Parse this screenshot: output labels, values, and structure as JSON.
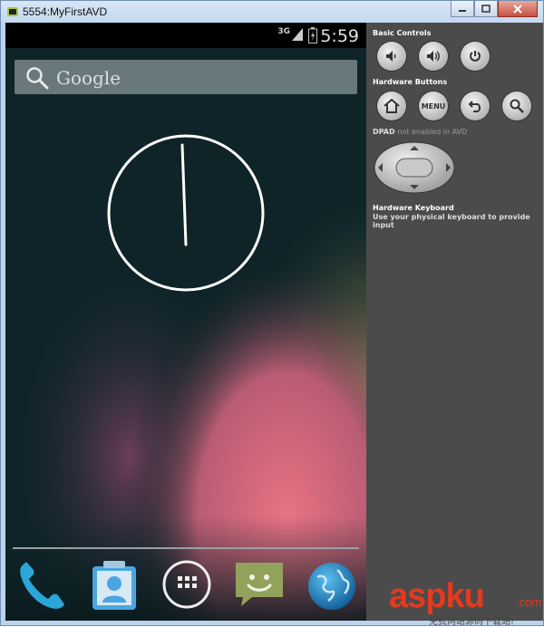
{
  "window": {
    "title": "5554:MyFirstAVD",
    "controls": [
      "minimize-icon",
      "maximize-icon",
      "close-icon"
    ]
  },
  "statusbar": {
    "network": "3G",
    "time": "5:59",
    "icons": [
      "signal-icon",
      "battery-icon"
    ]
  },
  "search": {
    "text": "Google",
    "icon": "search-icon"
  },
  "home": {
    "clock_widget": "analog-clock",
    "dock_apps": [
      {
        "name": "phone",
        "icon": "phone-icon"
      },
      {
        "name": "contacts",
        "icon": "contacts-icon"
      },
      {
        "name": "all-apps",
        "icon": "app-drawer-icon"
      },
      {
        "name": "messaging",
        "icon": "messaging-icon"
      },
      {
        "name": "browser",
        "icon": "globe-icon"
      }
    ]
  },
  "panel": {
    "basic_controls": {
      "heading": "Basic Controls",
      "buttons": [
        "volume-down-icon",
        "volume-up-icon",
        "power-icon"
      ]
    },
    "hardware_buttons": {
      "heading": "Hardware Buttons",
      "buttons": [
        "home-icon",
        "menu-button",
        "back-icon",
        "search-icon"
      ],
      "menu_label": "MENU"
    },
    "dpad": {
      "heading": "DPAD",
      "note": "not enabled in AVD"
    },
    "keyboard": {
      "heading": "Hardware Keyboard",
      "note": "Use your physical keyboard to provide input"
    }
  },
  "watermark": {
    "brand": "aspku",
    "suffix": ".com",
    "tagline": "免费网站源码下载站!"
  },
  "colors": {
    "titlebar": "#c4d8ef",
    "phone_bg": "#0e2428",
    "panel_bg": "#4b4b4b",
    "watermark": "#e33a20"
  }
}
